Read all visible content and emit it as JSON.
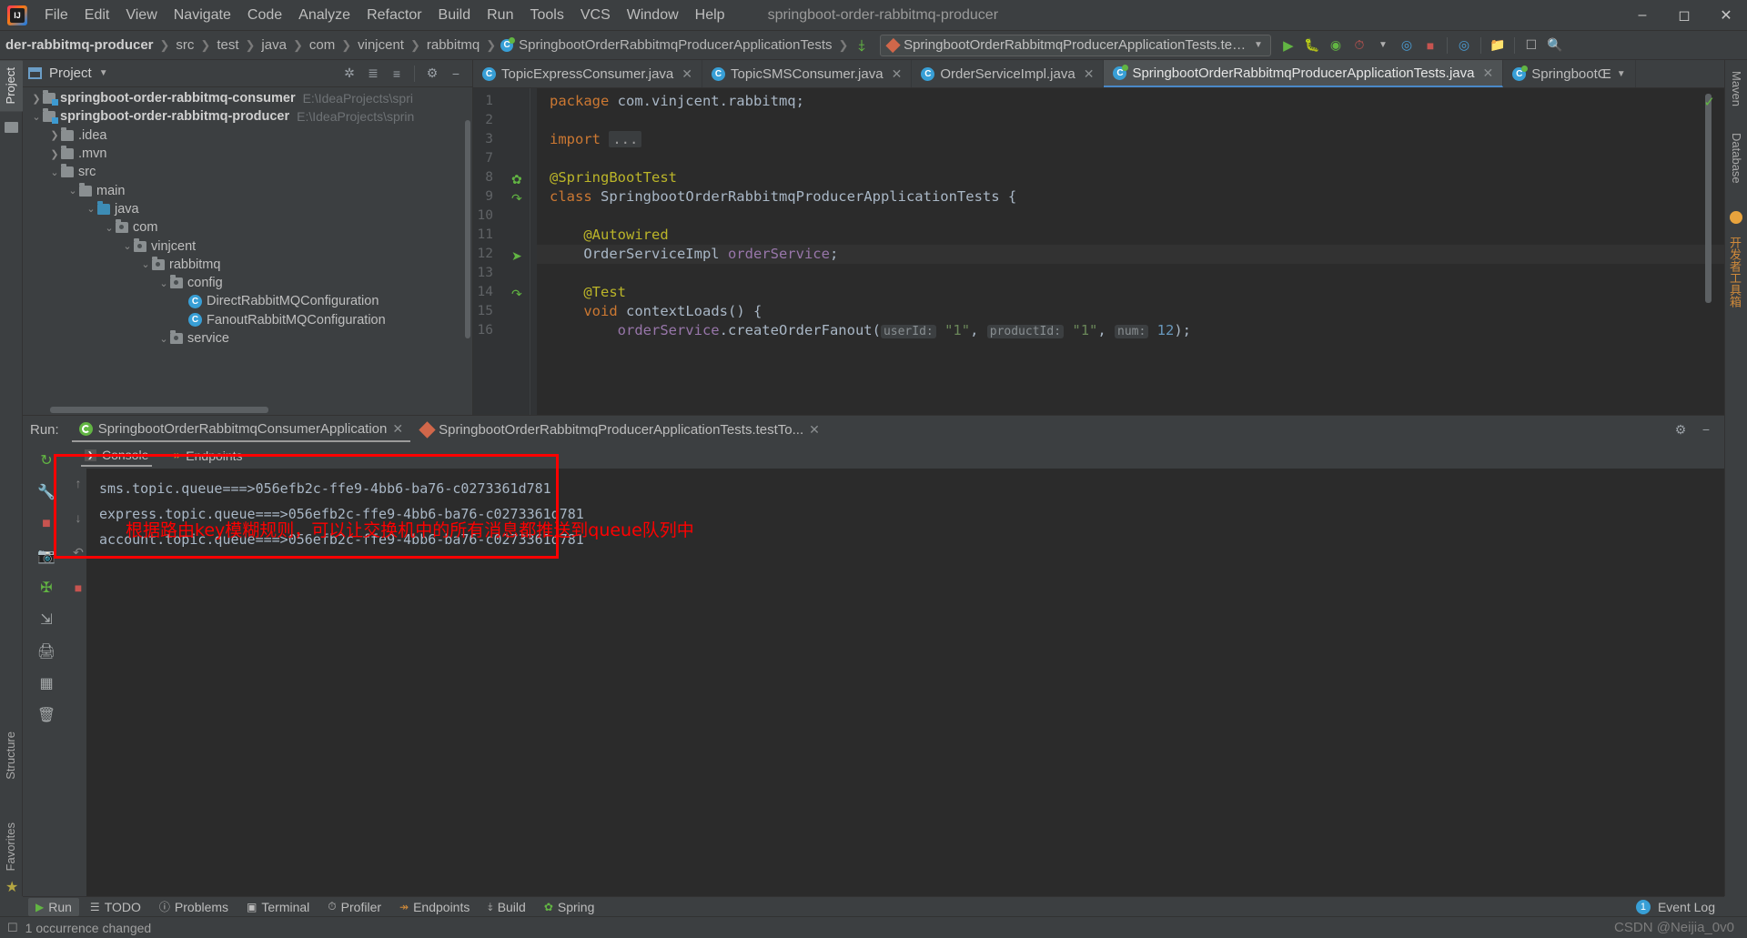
{
  "window": {
    "title": "springboot-order-rabbitmq-producer",
    "controls": [
      "minimize",
      "maximize",
      "close"
    ]
  },
  "menubar": {
    "items": [
      "File",
      "Edit",
      "View",
      "Navigate",
      "Code",
      "Analyze",
      "Refactor",
      "Build",
      "Run",
      "Tools",
      "VCS",
      "Window",
      "Help"
    ]
  },
  "navbar": {
    "breadcrumbs": [
      {
        "label": "der-rabbitmq-producer",
        "bold": true,
        "icon": null
      },
      {
        "label": "src",
        "bold": false,
        "icon": null
      },
      {
        "label": "test",
        "bold": false,
        "icon": null
      },
      {
        "label": "java",
        "bold": false,
        "icon": null
      },
      {
        "label": "com",
        "bold": false,
        "icon": null
      },
      {
        "label": "vinjcent",
        "bold": false,
        "icon": null
      },
      {
        "label": "rabbitmq",
        "bold": false,
        "icon": null
      },
      {
        "label": "SpringbootOrderRabbitmqProducerApplicationTests",
        "bold": false,
        "icon": "class-icon"
      }
    ],
    "run_config": "SpringbootOrderRabbitmqProducerApplicationTests.testTopic",
    "toolbar_icons": [
      "run-icon",
      "debug-icon",
      "run-with-coverage-icon",
      "profiler-icon",
      "chevron-down-icon",
      "spring-dashboard-icon",
      "stop-icon",
      "actuator-icon",
      "project-structure-icon",
      "terminal-icon",
      "search-icon"
    ]
  },
  "left_strip": {
    "tabs": [
      "Project",
      "Structure",
      "Favorites"
    ],
    "active": "Project",
    "bottom_icons": [
      "bookmark-star-icon"
    ]
  },
  "right_strip": {
    "tabs": [
      "Maven",
      "Database",
      "开发者工具箱"
    ]
  },
  "project_panel": {
    "title": "Project",
    "tool_icons": [
      "locate-icon",
      "expand-all-icon",
      "collapse-all-icon",
      "gear-icon",
      "hide-icon"
    ],
    "tree": [
      {
        "indent": 0,
        "arrow": "›",
        "icon": "module-icon",
        "label": "springboot-order-rabbitmq-consumer",
        "bold": true,
        "path": "E:\\IdeaProjects\\spri"
      },
      {
        "indent": 0,
        "arrow": "⌄",
        "icon": "module-icon",
        "label": "springboot-order-rabbitmq-producer",
        "bold": true,
        "path": "E:\\IdeaProjects\\sprin"
      },
      {
        "indent": 1,
        "arrow": "›",
        "icon": "folder-icon",
        "label": ".idea",
        "bold": false,
        "path": ""
      },
      {
        "indent": 1,
        "arrow": "›",
        "icon": "folder-icon",
        "label": ".mvn",
        "bold": false,
        "path": ""
      },
      {
        "indent": 1,
        "arrow": "⌄",
        "icon": "folder-icon",
        "label": "src",
        "bold": false,
        "path": ""
      },
      {
        "indent": 2,
        "arrow": "⌄",
        "icon": "folder-icon",
        "label": "main",
        "bold": false,
        "path": ""
      },
      {
        "indent": 3,
        "arrow": "⌄",
        "icon": "source-folder-icon",
        "label": "java",
        "bold": false,
        "path": ""
      },
      {
        "indent": 4,
        "arrow": "⌄",
        "icon": "package-icon",
        "label": "com",
        "bold": false,
        "path": ""
      },
      {
        "indent": 5,
        "arrow": "⌄",
        "icon": "package-icon",
        "label": "vinjcent",
        "bold": false,
        "path": ""
      },
      {
        "indent": 6,
        "arrow": "⌄",
        "icon": "package-icon",
        "label": "rabbitmq",
        "bold": false,
        "path": ""
      },
      {
        "indent": 7,
        "arrow": "⌄",
        "icon": "package-icon",
        "label": "config",
        "bold": false,
        "path": ""
      },
      {
        "indent": 8,
        "arrow": "",
        "icon": "class-icon",
        "label": "DirectRabbitMQConfiguration",
        "bold": false,
        "path": ""
      },
      {
        "indent": 8,
        "arrow": "",
        "icon": "class-icon",
        "label": "FanoutRabbitMQConfiguration",
        "bold": false,
        "path": ""
      },
      {
        "indent": 7,
        "arrow": "⌄",
        "icon": "package-icon",
        "label": "service",
        "bold": false,
        "path": ""
      }
    ]
  },
  "editor": {
    "tabs": [
      {
        "label": "TopicExpressConsumer.java",
        "icon": "java-class-icon",
        "active": false,
        "closable": true
      },
      {
        "label": "TopicSMSConsumer.java",
        "icon": "java-class-icon",
        "active": false,
        "closable": true
      },
      {
        "label": "OrderServiceImpl.java",
        "icon": "java-class-icon",
        "active": false,
        "closable": true
      },
      {
        "label": "SpringbootOrderRabbitmqProducerApplicationTests.java",
        "icon": "spring-test-class-icon",
        "active": true,
        "closable": true
      },
      {
        "label": "SpringbootŒ",
        "icon": "spring-class-icon",
        "active": false,
        "closable": false
      }
    ],
    "gutter_numbers": [
      "1",
      "2",
      "3",
      "7",
      "8",
      "9",
      "10",
      "11",
      "12",
      "13",
      "14",
      "15",
      "16"
    ],
    "gutter_marks": [
      {
        "line": "8",
        "icon": "spring-bean-icon"
      },
      {
        "line": "9",
        "icon": "run-test-icon"
      },
      {
        "line": "12",
        "icon": "bean-injection-icon"
      },
      {
        "line": "15",
        "icon": "run-test-icon"
      }
    ],
    "lines": [
      {
        "num": "1",
        "tokens": [
          {
            "t": "package ",
            "c": "kw"
          },
          {
            "t": "com.vinjcent.rabbitmq;",
            "c": "plain"
          }
        ]
      },
      {
        "num": "2",
        "tokens": []
      },
      {
        "num": "3",
        "tokens": [
          {
            "t": "import ",
            "c": "kw"
          },
          {
            "t": "...",
            "c": "fold"
          }
        ]
      },
      {
        "num": "7",
        "tokens": []
      },
      {
        "num": "8",
        "tokens": [
          {
            "t": "@SpringBootTest",
            "c": "ann"
          }
        ]
      },
      {
        "num": "9",
        "tokens": [
          {
            "t": "class ",
            "c": "kw"
          },
          {
            "t": "SpringbootOrderRabbitmqProducerApplicationTests {",
            "c": "plain"
          }
        ]
      },
      {
        "num": "10",
        "tokens": []
      },
      {
        "num": "11",
        "tokens": [
          {
            "t": "    @Autowired",
            "c": "ann"
          }
        ]
      },
      {
        "num": "12",
        "tokens": [
          {
            "t": "    OrderServiceImpl ",
            "c": "plain"
          },
          {
            "t": "orderService",
            "c": "fld"
          },
          {
            "t": ";",
            "c": "punct"
          }
        ],
        "highlight": true
      },
      {
        "num": "13",
        "tokens": []
      },
      {
        "num": "14",
        "tokens": [
          {
            "t": "    @Test",
            "c": "ann"
          }
        ]
      },
      {
        "num": "15",
        "tokens": [
          {
            "t": "    void ",
            "c": "kw"
          },
          {
            "t": "contextLoads",
            "c": "plain"
          },
          {
            "t": "() {",
            "c": "punct"
          }
        ]
      },
      {
        "num": "16",
        "tokens": [
          {
            "t": "        ",
            "c": "plain"
          },
          {
            "t": "orderService",
            "c": "fld"
          },
          {
            "t": ".createOrderFanout(",
            "c": "plain"
          },
          {
            "t": "userId:",
            "c": "hint"
          },
          {
            "t": " \"1\"",
            "c": "str"
          },
          {
            "t": ", ",
            "c": "punct"
          },
          {
            "t": "productId:",
            "c": "hint"
          },
          {
            "t": " \"1\"",
            "c": "str"
          },
          {
            "t": ", ",
            "c": "punct"
          },
          {
            "t": "num:",
            "c": "hint"
          },
          {
            "t": " 12",
            "c": "num"
          },
          {
            "t": ");",
            "c": "punct"
          }
        ]
      }
    ],
    "inspection_status": "ok"
  },
  "run_window": {
    "run_label": "Run:",
    "tabs": [
      {
        "label": "SpringbootOrderRabbitmqConsumerApplication",
        "icon": "spring-boot-icon",
        "active": true,
        "closable": true
      },
      {
        "label": "SpringbootOrderRabbitmqProducerApplicationTests.testTo...",
        "icon": "test-icon",
        "active": false,
        "closable": true
      }
    ],
    "header_icons": [
      "gear-icon",
      "hide-icon"
    ],
    "sidebar_icons": [
      "rerun-icon",
      "wrench-icon",
      "stop-icon",
      "camera-icon",
      "thread-dump-icon",
      "export-icon",
      "print-icon",
      "layout-icon",
      "trash-icon"
    ],
    "console_tabs": [
      {
        "label": "Console",
        "icon": "console-icon",
        "active": true
      },
      {
        "label": "Endpoints",
        "icon": "endpoints-icon",
        "active": false
      }
    ],
    "scroll_icons": [
      "scroll-up-icon",
      "scroll-down-icon",
      "soft-wrap-icon"
    ],
    "console_output": [
      "sms.topic.queue===>056efb2c-ffe9-4bb6-ba76-c0273361d781",
      "express.topic.queue===>056efb2c-ffe9-4bb6-ba76-c0273361d781",
      "account.topic.queue===>056efb2c-ffe9-4bb6-ba76-c0273361d781"
    ]
  },
  "annotation": {
    "text": "根据路由key模糊规则，可以让交换机中的所有消息都推送到queue队列中",
    "color": "#ff0000"
  },
  "bottom_tabs": {
    "items": [
      {
        "label": "Run",
        "icon": "run-icon",
        "active": true
      },
      {
        "label": "TODO",
        "icon": "todo-icon",
        "active": false
      },
      {
        "label": "Problems",
        "icon": "problems-icon",
        "active": false
      },
      {
        "label": "Terminal",
        "icon": "terminal-icon",
        "active": false
      },
      {
        "label": "Profiler",
        "icon": "profiler-icon",
        "active": false
      },
      {
        "label": "Endpoints",
        "icon": "endpoints-icon",
        "active": false
      },
      {
        "label": "Build",
        "icon": "build-icon",
        "active": false
      },
      {
        "label": "Spring",
        "icon": "spring-icon",
        "active": false
      }
    ],
    "event_log": {
      "label": "Event Log",
      "count": "1"
    }
  },
  "statusbar": {
    "message": "1 occurrence changed",
    "watermark": "CSDN @Neijia_0v0"
  },
  "colors": {
    "accent_blue": "#389fd6",
    "annotation_red": "#ff0000",
    "editor_bg": "#2b2b2b",
    "panel_bg": "#3c3f41",
    "spring_green": "#62b543"
  }
}
